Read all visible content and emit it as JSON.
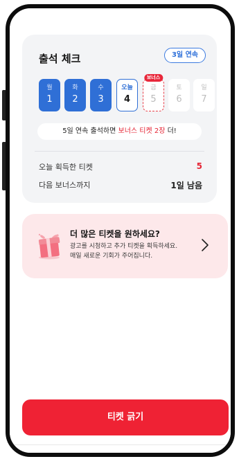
{
  "attendance": {
    "title": "출석 체크",
    "streak_badge": "3일 연속",
    "days": [
      {
        "label": "월",
        "num": "1",
        "state": "done"
      },
      {
        "label": "화",
        "num": "2",
        "state": "done"
      },
      {
        "label": "수",
        "num": "3",
        "state": "done"
      },
      {
        "label": "오늘",
        "num": "4",
        "state": "today"
      },
      {
        "label": "금",
        "num": "5",
        "state": "bonus",
        "tag": "보너스"
      },
      {
        "label": "토",
        "num": "6",
        "state": "future"
      },
      {
        "label": "일",
        "num": "7",
        "state": "future"
      }
    ],
    "notice_prefix": "5일 연속 출석하면 ",
    "notice_highlight": "보너스 티켓 2장",
    "notice_suffix": " 더!",
    "stats": {
      "today_label": "오늘 획득한 티켓",
      "today_value": "5",
      "next_label": "다음 보너스까지",
      "next_value": "1일 남음"
    }
  },
  "promo": {
    "title": "더 많은 티켓을 원하세요?",
    "desc_line1": "광고를 시청하고 추가 티켓을 획득하세요.",
    "desc_line2": "매일 새로운 기회가 주어집니다."
  },
  "cta": {
    "label": "티켓 긁기"
  },
  "colors": {
    "primary_blue": "#2f6fd6",
    "accent_red": "#ef2234",
    "promo_bg": "#fde8ea"
  },
  "icons": {
    "promo": "gift-icon",
    "chevron": "chevron-right-icon"
  }
}
